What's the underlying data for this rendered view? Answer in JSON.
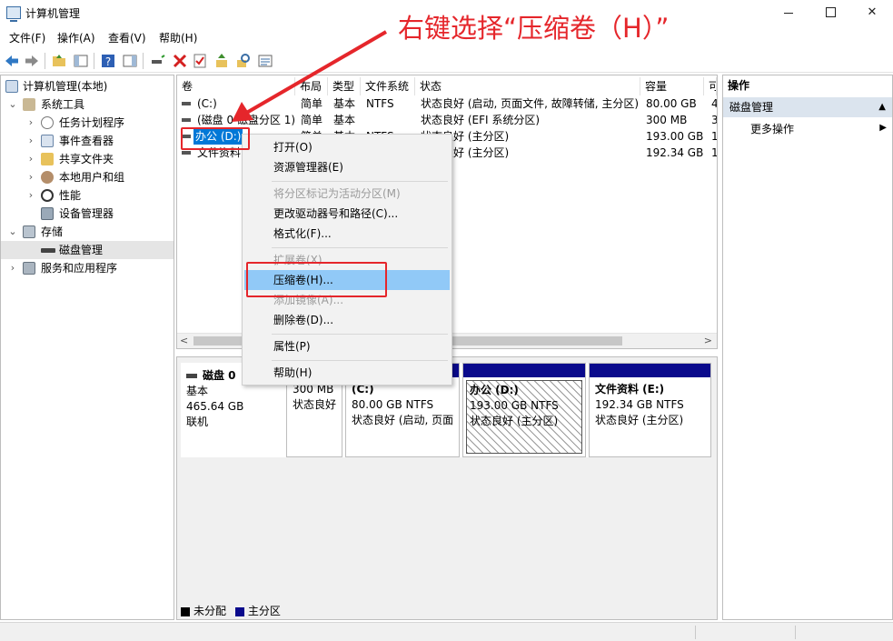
{
  "window": {
    "title": "计算机管理",
    "controls": {
      "minimize": "",
      "maximize": "",
      "close": "✕"
    }
  },
  "menubar": [
    "文件(F)",
    "操作(A)",
    "查看(V)",
    "帮助(H)"
  ],
  "tree": {
    "root": "计算机管理(本地)",
    "system_tools": "系统工具",
    "task_scheduler": "任务计划程序",
    "event_viewer": "事件查看器",
    "shared_folders": "共享文件夹",
    "local_users": "本地用户和组",
    "performance": "性能",
    "device_manager": "设备管理器",
    "storage": "存储",
    "disk_management": "磁盘管理",
    "services": "服务和应用程序"
  },
  "volumes": {
    "columns": [
      "卷",
      "布局",
      "类型",
      "文件系统",
      "状态",
      "容量",
      "可"
    ],
    "rows": [
      {
        "name": "(C:)",
        "layout": "简单",
        "type": "基本",
        "fs": "NTFS",
        "status": "状态良好 (启动, 页面文件, 故障转储, 主分区)",
        "capacity": "80.00 GB",
        "free": "4"
      },
      {
        "name": "(磁盘 0 磁盘分区 1)",
        "layout": "简单",
        "type": "基本",
        "fs": "",
        "status": "状态良好 (EFI 系统分区)",
        "capacity": "300 MB",
        "free": "3"
      },
      {
        "name": "办公 (D:)",
        "layout": "简单",
        "type": "基本",
        "fs": "NTFS",
        "status": "状态良好 (主分区)",
        "capacity": "193.00 GB",
        "free": "1"
      },
      {
        "name": "文件资料",
        "layout": "",
        "type": "",
        "fs": "",
        "status": "状态良好 (主分区)",
        "capacity": "192.34 GB",
        "free": "1"
      }
    ]
  },
  "scroll": {
    "left": "<",
    "right": ">"
  },
  "disk": {
    "name": "磁盘 0",
    "type": "基本",
    "size": "465.64 GB",
    "state": "联机",
    "partitions": [
      {
        "name": "",
        "size": "300 MB",
        "status": "状态良好"
      },
      {
        "name": "(C:)",
        "size": "80.00 GB NTFS",
        "status": "状态良好 (启动, 页面"
      },
      {
        "name": "办公 (D:)",
        "size": "193.00 GB NTFS",
        "status": "状态良好 (主分区)"
      },
      {
        "name": "文件资料 (E:)",
        "size": "192.34 GB NTFS",
        "status": "状态良好 (主分区)"
      }
    ]
  },
  "legend": {
    "unallocated": "未分配",
    "primary": "主分区"
  },
  "actions": {
    "header": "操作",
    "group": "磁盘管理",
    "more": "更多操作"
  },
  "context_menu": {
    "open": "打开(O)",
    "explorer": "资源管理器(E)",
    "mark_active": "将分区标记为活动分区(M)",
    "change_letter": "更改驱动器号和路径(C)...",
    "format": "格式化(F)...",
    "extend": "扩展卷(X)...",
    "shrink": "压缩卷(H)...",
    "mirror": "添加镜像(A)...",
    "delete": "删除卷(D)...",
    "properties": "属性(P)",
    "help": "帮助(H)"
  },
  "annotation": {
    "text": "右键选择“压缩卷（H）”"
  },
  "colors": {
    "accent": "#0078d7",
    "annotation": "#e5262b",
    "partition_bar": "#0a0a8c",
    "menu_hover": "#91c9f7"
  }
}
